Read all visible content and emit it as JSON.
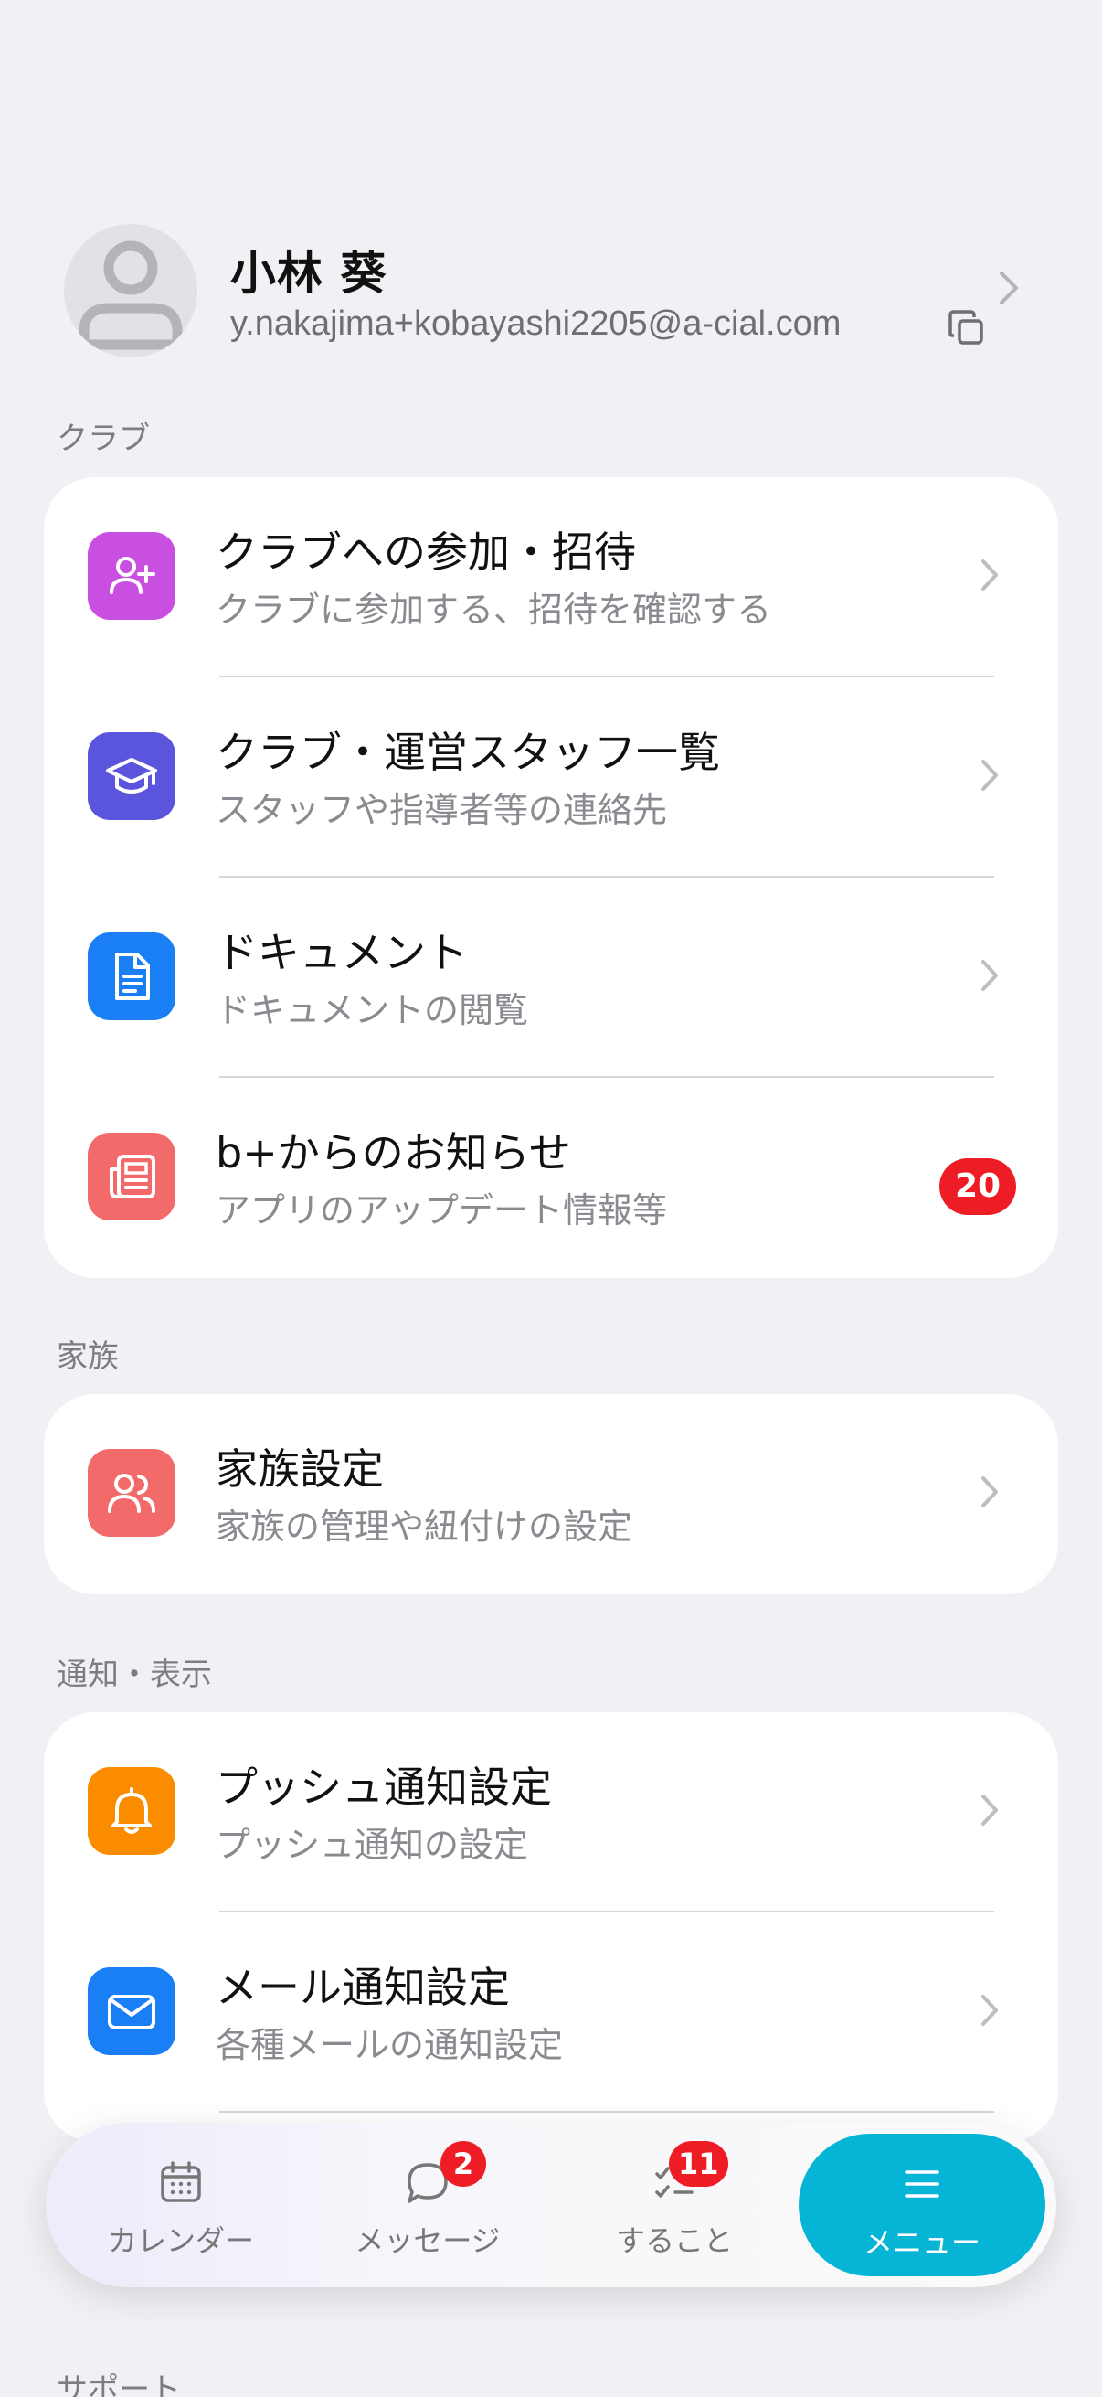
{
  "profile": {
    "name": "小林 葵",
    "email": "y.nakajima+kobayashi2205@a-cial.com"
  },
  "sections": {
    "club": {
      "title": "クラブ",
      "items": [
        {
          "title": "クラブへの参加・招待",
          "subtitle": "クラブに参加する、招待を確認する",
          "icon": "user-plus-icon",
          "color": "#c94fe0"
        },
        {
          "title": "クラブ・運営スタッフ一覧",
          "subtitle": "スタッフや指導者等の連絡先",
          "icon": "graduation-cap-icon",
          "color": "#5a55dc"
        },
        {
          "title": "ドキュメント",
          "subtitle": "ドキュメントの閲覧",
          "icon": "document-icon",
          "color": "#1a7ff5"
        },
        {
          "title": "b+からのお知らせ",
          "subtitle": "アプリのアップデート情報等",
          "icon": "newspaper-icon",
          "color": "#f36a6a",
          "badge": "20"
        }
      ]
    },
    "family": {
      "title": "家族",
      "items": [
        {
          "title": "家族設定",
          "subtitle": "家族の管理や紐付けの設定",
          "icon": "users-icon",
          "color": "#f36a6a"
        }
      ]
    },
    "notify": {
      "title": "通知・表示",
      "items": [
        {
          "title": "プッシュ通知設定",
          "subtitle": "プッシュ通知の設定",
          "icon": "bell-icon",
          "color": "#fb8c00"
        },
        {
          "title": "メール通知設定",
          "subtitle": "各種メールの通知設定",
          "icon": "mail-icon",
          "color": "#1a7ff5"
        }
      ]
    },
    "support": {
      "title": "サポート"
    }
  },
  "tabbar": {
    "tabs": [
      {
        "label": "カレンダー",
        "icon": "calendar-icon"
      },
      {
        "label": "メッセージ",
        "icon": "chat-icon",
        "badge": "2"
      },
      {
        "label": "すること",
        "icon": "checklist-icon",
        "badge": "11"
      },
      {
        "label": "メニュー",
        "icon": "menu-icon",
        "active": true
      }
    ]
  }
}
